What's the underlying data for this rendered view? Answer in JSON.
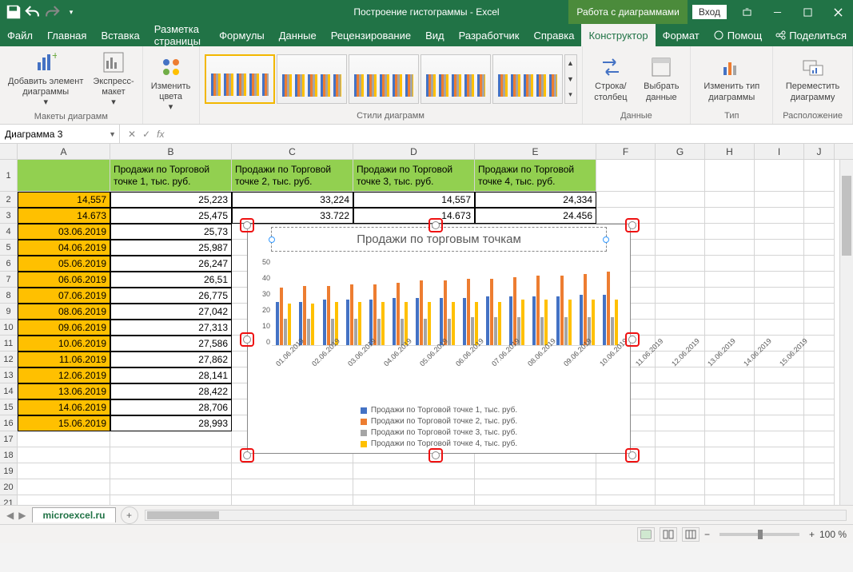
{
  "app": {
    "title": "Построение гистограммы  -  Excel",
    "context_tab": "Работа с диаграммами",
    "login": "Вход"
  },
  "ribbon_tabs": [
    "Файл",
    "Главная",
    "Вставка",
    "Разметка страницы",
    "Формулы",
    "Данные",
    "Рецензирование",
    "Вид",
    "Разработчик",
    "Справка",
    "Конструктор",
    "Формат"
  ],
  "ribbon_right": {
    "help": "Помощ",
    "share": "Поделиться"
  },
  "groups": {
    "layouts": {
      "label": "Макеты диаграмм",
      "add_element": "Добавить элемент диаграммы",
      "quick": "Экспресс-макет"
    },
    "colors": {
      "btn": "Изменить цвета"
    },
    "styles": {
      "label": "Стили диаграмм"
    },
    "data": {
      "label": "Данные",
      "switch": "Строка/ столбец",
      "select": "Выбрать данные"
    },
    "type": {
      "label": "Тип",
      "change": "Изменить тип диаграммы"
    },
    "location": {
      "label": "Расположение",
      "move": "Переместить диаграмму"
    }
  },
  "namebox": "Диаграмма 3",
  "fx_label": "fx",
  "cols": [
    "A",
    "B",
    "C",
    "D",
    "E",
    "F",
    "G",
    "H",
    "I",
    "J"
  ],
  "col_widths": [
    "w-a",
    "w-b",
    "w-c",
    "w-d",
    "w-e",
    "w-f",
    "w-g",
    "w-h",
    "w-i",
    "w-j"
  ],
  "headers": [
    "",
    "Продажи по Торговой точке 1, тыс. руб.",
    "Продажи по Торговой точке 2, тыс. руб.",
    "Продажи по Торговой точке 3, тыс. руб.",
    "Продажи по Торговой точке 4, тыс. руб."
  ],
  "rows": [
    {
      "n": 2,
      "d": "14,557",
      "b": "25,223",
      "c": "33,224",
      "e": "24,334"
    },
    {
      "n": 3,
      "d": "14.673",
      "b": "25,475",
      "c": "33.722",
      "e": "24.456"
    },
    {
      "n": 4,
      "d": "03.06.2019",
      "b": "25,73"
    },
    {
      "n": 5,
      "d": "04.06.2019",
      "b": "25,987"
    },
    {
      "n": 6,
      "d": "05.06.2019",
      "b": "26,247"
    },
    {
      "n": 7,
      "d": "06.06.2019",
      "b": "26,51"
    },
    {
      "n": 8,
      "d": "07.06.2019",
      "b": "26,775"
    },
    {
      "n": 9,
      "d": "08.06.2019",
      "b": "27,042"
    },
    {
      "n": 10,
      "d": "09.06.2019",
      "b": "27,313"
    },
    {
      "n": 11,
      "d": "10.06.2019",
      "b": "27,586"
    },
    {
      "n": 12,
      "d": "11.06.2019",
      "b": "27,862"
    },
    {
      "n": 13,
      "d": "12.06.2019",
      "b": "28,141"
    },
    {
      "n": 14,
      "d": "13.06.2019",
      "b": "28,422"
    },
    {
      "n": 15,
      "d": "14.06.2019",
      "b": "28,706"
    },
    {
      "n": 16,
      "d": "15.06.2019",
      "b": "28,993"
    }
  ],
  "empty_rows": [
    17,
    18,
    19,
    20,
    21
  ],
  "chart": {
    "title": "Продажи по торговым точкам"
  },
  "chart_data": {
    "type": "bar",
    "title": "Продажи по торговым точкам",
    "ylabel": "",
    "xlabel": "",
    "ylim": [
      0,
      50
    ],
    "yticks": [
      0,
      10,
      20,
      30,
      40,
      50
    ],
    "categories": [
      "01.06.2019",
      "02.06.2019",
      "03.06.2019",
      "04.06.2019",
      "05.06.2019",
      "06.06.2019",
      "07.06.2019",
      "08.06.2019",
      "09.06.2019",
      "10.06.2019",
      "11.06.2019",
      "12.06.2019",
      "13.06.2019",
      "14.06.2019",
      "15.06.2019"
    ],
    "series": [
      {
        "name": "Продажи по Торговой точке 1, тыс. руб.",
        "color": "#4472c4",
        "values": [
          25,
          25,
          26,
          26,
          26,
          27,
          27,
          27,
          27,
          28,
          28,
          28,
          28,
          29,
          29
        ]
      },
      {
        "name": "Продажи по Торговой точке 2, тыс. руб.",
        "color": "#ed7d31",
        "values": [
          33,
          34,
          34,
          35,
          35,
          36,
          37,
          37,
          38,
          38,
          39,
          40,
          40,
          41,
          42
        ]
      },
      {
        "name": "Продажи по Торговой точке 3, тыс. руб.",
        "color": "#a5a5a5",
        "values": [
          15,
          15,
          15,
          15,
          15,
          15,
          15,
          15,
          16,
          16,
          16,
          16,
          16,
          16,
          16
        ]
      },
      {
        "name": "Продажи по Торговой точке 4, тыс. руб.",
        "color": "#ffc000",
        "values": [
          24,
          24,
          25,
          25,
          25,
          25,
          25,
          25,
          25,
          25,
          26,
          26,
          26,
          26,
          26
        ]
      }
    ]
  },
  "sheet": {
    "name": "microexcel.ru"
  },
  "zoom": "100 %"
}
